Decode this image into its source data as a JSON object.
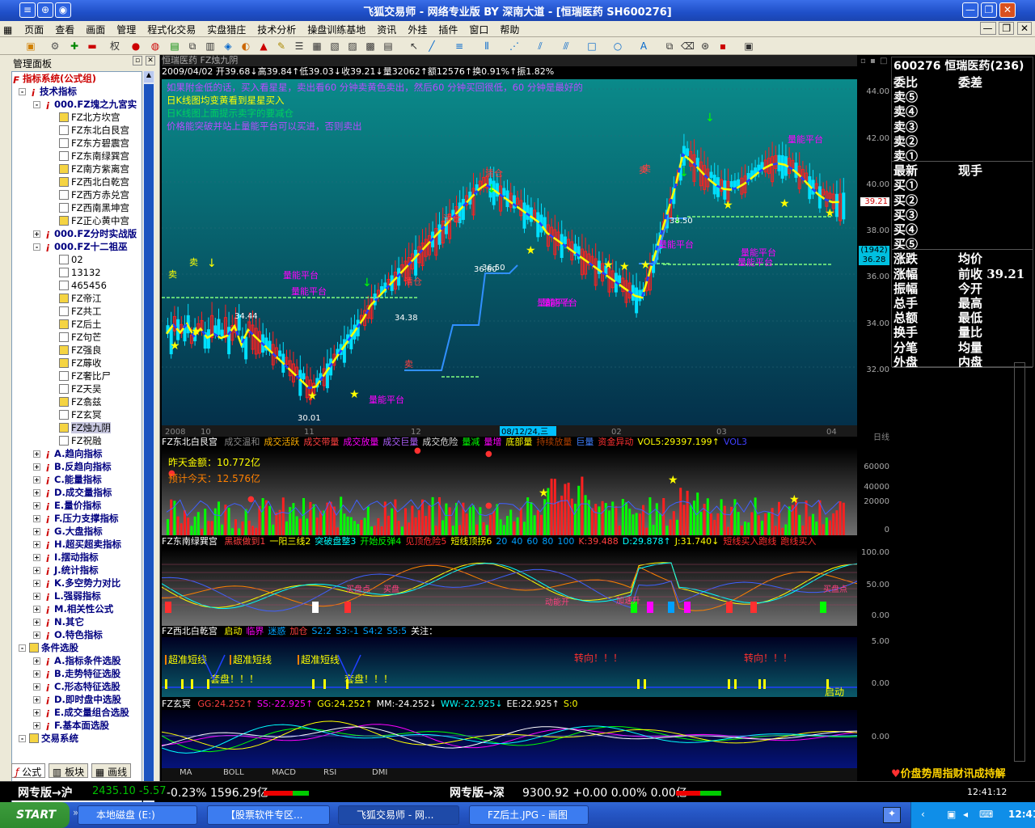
{
  "titlebar": {
    "title": "飞狐交易师 - 网络专业版 BY 深南大道 - [恒瑞医药 SH600276]"
  },
  "menu": [
    "页面",
    "查看",
    "画面",
    "管理",
    "程式化交易",
    "实盘猎庄",
    "技术分析",
    "操盘训练基地",
    "资讯",
    "外挂",
    "插件",
    "窗口",
    "帮助"
  ],
  "toolbar": {
    "period_label": "权"
  },
  "left_panel": {
    "title": "管理面板",
    "tree": [
      {
        "label": "指标系统(公式组)",
        "level": 0,
        "style": "red",
        "icon": "F"
      },
      {
        "label": "技术指标",
        "level": 1,
        "style": "bold",
        "icon": "i",
        "toggle": "-"
      },
      {
        "label": "000.FZ塊之九宮实",
        "level": 2,
        "style": "bold",
        "icon": "i",
        "toggle": "-"
      },
      {
        "label": "FZ北方坎宫",
        "level": 3,
        "icon": "yel"
      },
      {
        "label": "FZ东北白艮宫",
        "level": 3,
        "icon": "box"
      },
      {
        "label": "FZ东方碧震宫",
        "level": 3,
        "icon": "box"
      },
      {
        "label": "FZ东南绿巽宫",
        "level": 3,
        "icon": "box"
      },
      {
        "label": "FZ南方紫离宫",
        "level": 3,
        "icon": "yel"
      },
      {
        "label": "FZ西北白乾宫",
        "level": 3,
        "icon": "yel"
      },
      {
        "label": "FZ西方赤兑宫",
        "level": 3,
        "icon": "box"
      },
      {
        "label": "FZ西南黑坤宫",
        "level": 3,
        "icon": "box"
      },
      {
        "label": "FZ正心黄中宫",
        "level": 3,
        "icon": "yel"
      },
      {
        "label": "000.FZ分时实战版",
        "level": 2,
        "style": "bold",
        "icon": "i",
        "toggle": "+"
      },
      {
        "label": "000.FZ十二祖巫",
        "level": 2,
        "style": "bold",
        "icon": "i",
        "toggle": "-"
      },
      {
        "label": "02",
        "level": 3,
        "icon": "box"
      },
      {
        "label": "13132",
        "level": 3,
        "icon": "box"
      },
      {
        "label": "465456",
        "level": 3,
        "icon": "box"
      },
      {
        "label": "FZ帝江",
        "level": 3,
        "icon": "yel"
      },
      {
        "label": "FZ共工",
        "level": 3,
        "icon": "box"
      },
      {
        "label": "FZ后土",
        "level": 3,
        "icon": "yel"
      },
      {
        "label": "FZ句芒",
        "level": 3,
        "icon": "box"
      },
      {
        "label": "FZ强良",
        "level": 3,
        "icon": "yel"
      },
      {
        "label": "FZ蓐收",
        "level": 3,
        "icon": "yel"
      },
      {
        "label": "FZ奢比尸",
        "level": 3,
        "icon": "box"
      },
      {
        "label": "FZ天吴",
        "level": 3,
        "icon": "box"
      },
      {
        "label": "FZ翕兹",
        "level": 3,
        "icon": "yel"
      },
      {
        "label": "FZ玄冥",
        "level": 3,
        "icon": "box"
      },
      {
        "label": "FZ烛九阴",
        "level": 3,
        "icon": "yel",
        "selected": true
      },
      {
        "label": "FZ祝融",
        "level": 3,
        "icon": "box"
      },
      {
        "label": "A.趋向指标",
        "level": 2,
        "style": "bold",
        "icon": "i",
        "toggle": "+"
      },
      {
        "label": "B.反趋向指标",
        "level": 2,
        "style": "bold",
        "icon": "i",
        "toggle": "+"
      },
      {
        "label": "C.能量指标",
        "level": 2,
        "style": "bold",
        "icon": "i",
        "toggle": "+"
      },
      {
        "label": "D.成交量指标",
        "level": 2,
        "style": "bold",
        "icon": "i",
        "toggle": "+"
      },
      {
        "label": "E.量价指标",
        "level": 2,
        "style": "bold",
        "icon": "i",
        "toggle": "+"
      },
      {
        "label": "F.压力支撑指标",
        "level": 2,
        "style": "bold",
        "icon": "i",
        "toggle": "+"
      },
      {
        "label": "G.大盘指标",
        "level": 2,
        "style": "bold",
        "icon": "i",
        "toggle": "+"
      },
      {
        "label": "H.超买超卖指标",
        "level": 2,
        "style": "bold",
        "icon": "i",
        "toggle": "+"
      },
      {
        "label": "I.摆动指标",
        "level": 2,
        "style": "bold",
        "icon": "i",
        "toggle": "+"
      },
      {
        "label": "J.统计指标",
        "level": 2,
        "style": "bold",
        "icon": "i",
        "toggle": "+"
      },
      {
        "label": "K.多空势力对比",
        "level": 2,
        "style": "bold",
        "icon": "i",
        "toggle": "+"
      },
      {
        "label": "L.强弱指标",
        "level": 2,
        "style": "bold",
        "icon": "i",
        "toggle": "+"
      },
      {
        "label": "M.相关性公式",
        "level": 2,
        "style": "bold",
        "icon": "i",
        "toggle": "+"
      },
      {
        "label": "N.其它",
        "level": 2,
        "style": "bold",
        "icon": "i",
        "toggle": "+"
      },
      {
        "label": "O.特色指标",
        "level": 2,
        "style": "bold",
        "icon": "i",
        "toggle": "+"
      },
      {
        "label": "条件选股",
        "level": 1,
        "style": "bold",
        "icon": "yel",
        "toggle": "-"
      },
      {
        "label": "A.指标条件选股",
        "level": 2,
        "style": "bold",
        "icon": "i",
        "toggle": "+"
      },
      {
        "label": "B.走势特征选股",
        "level": 2,
        "style": "bold",
        "icon": "i",
        "toggle": "+"
      },
      {
        "label": "C.形态特征选股",
        "level": 2,
        "style": "bold",
        "icon": "i",
        "toggle": "+"
      },
      {
        "label": "D.即时盘中选股",
        "level": 2,
        "style": "bold",
        "icon": "i",
        "toggle": "+"
      },
      {
        "label": "E.成交量组合选股",
        "level": 2,
        "style": "bold",
        "icon": "i",
        "toggle": "+"
      },
      {
        "label": "F.基本面选股",
        "level": 2,
        "style": "bold",
        "icon": "i",
        "toggle": "+"
      },
      {
        "label": "交易系统",
        "level": 1,
        "style": "bold",
        "icon": "yel",
        "toggle": "-"
      }
    ],
    "tabs": [
      "公式",
      "板块",
      "画线"
    ]
  },
  "chart": {
    "stock_name": "恒瑞医药",
    "indicator_name": "FZ烛九阴",
    "info_line": "2009/04/02 开39.68↓高39.84↑低39.03↓收39.21↓量32062↑额12576↑换0.91%↑振1.82%",
    "tips": [
      "如果附金低的话，买入看星星，卖出看60 分钟卖黄色卖出，然后60 分钟买回很低，60 分钟是最好的",
      "日K线图均变黄看到星星买入",
      "日K线图上面提示卖字的要减仓",
      "价格能突破并站上量能平台可以买进，否则卖出"
    ],
    "tips_colors": [
      "#b94cff",
      "#ffff00",
      "#00a0ff",
      "#00d060",
      "#b94cff"
    ],
    "price_axis": [
      "44.00",
      "42.00",
      "40.00",
      "38.00",
      "36.00",
      "34.00",
      "32.00"
    ],
    "price_tag": "39.21",
    "price_tag2_top": "(1942)",
    "price_tag2": "36.28",
    "time_axis": [
      "2008",
      "10",
      "11",
      "12",
      "02",
      "03",
      "04"
    ],
    "time_cursor": "08/12/24,三",
    "date_label": "日线",
    "low_label": "30.01",
    "annotations": [
      "卖",
      "卖",
      "清仓",
      "卖",
      "量能平台",
      "量能平台",
      "量能平台",
      "量能平台",
      "量能平台",
      "量能平台",
      "量能平台",
      "量能平台",
      "量能平台",
      "卖",
      "清仓",
      "清仓",
      "卖"
    ],
    "platform_values": [
      "34.44",
      "34.38",
      "36.50",
      "36.60",
      "38.50"
    ]
  },
  "panel2": {
    "title": "FZ东北白艮宫",
    "legend": [
      "成交温和",
      "成交活跃",
      "成交带量",
      "成交放量",
      "成交巨量",
      "成交危险",
      "量减",
      "量增",
      "底部量",
      "持续放量",
      "巨量",
      "资金异动",
      "VOL5:29397.199↑",
      "VOL3"
    ],
    "legend_colors": [
      "#888",
      "#ffb000",
      "#ff4040",
      "#ff00ff",
      "#b060ff",
      "#ddd",
      "#00ff00",
      "#ff00ff",
      "#ffff00",
      "#b04000",
      "#4080ff",
      "#ff3030",
      "#ffff00",
      "#4040ff"
    ],
    "amount_yesterday": "昨天金额：10.772亿",
    "amount_today": "预计今天：12.576亿",
    "axis": [
      "60000",
      "40000",
      "20000",
      "0"
    ]
  },
  "panel3": {
    "title": "FZ东南绿巽宫",
    "legend": [
      "黑碳做到1",
      "一阳三线2",
      "突破盘整3",
      "开始反弹4",
      "见顶危险5",
      "短线顶拐6",
      "20",
      "40",
      "60",
      "80",
      "100",
      "K:39.488",
      "D:29.878↑",
      "J:31.740↓",
      "短线买入跑线",
      "跑线买入"
    ],
    "axis": [
      "100.00",
      "50.00",
      "0.00"
    ],
    "labels": [
      "买盘点",
      "买盘",
      "动能开",
      "加速升",
      "买盘点"
    ]
  },
  "panel4": {
    "title": "FZ西北白乾宫",
    "legend": [
      "启动",
      "临界",
      "迷惑",
      "加仓",
      "S2:2",
      "S3:-1",
      "S4:2",
      "S5:5",
      "关注："
    ],
    "axis": [
      "5.00",
      "0.00"
    ],
    "labels": [
      "超准短线",
      "超准短线",
      "超准短线",
      "转向！！！",
      "转向！！！",
      "套盘！！！",
      "套盘！！！",
      "启动"
    ]
  },
  "panel5": {
    "title": "FZ玄冥",
    "legend": [
      "GG:24.252↑",
      "SS:-22.925↑",
      "GG:24.252↑",
      "MM:-24.252↓",
      "WW:-22.925↓",
      "EE:22.925↑",
      "S:0"
    ],
    "axis": [
      "0.00"
    ]
  },
  "bottom_tabs": [
    "MA",
    "BOLL",
    "MACD",
    "RSI",
    "DMI"
  ],
  "quote": {
    "header": "600276 恒瑞医药(236)",
    "rows": [
      [
        "委比",
        "委差"
      ],
      [
        "卖⑤",
        ""
      ],
      [
        "卖④",
        ""
      ],
      [
        "卖③",
        ""
      ],
      [
        "卖②",
        ""
      ],
      [
        "卖①",
        ""
      ],
      [
        "最新",
        "现手"
      ],
      [
        "买①",
        ""
      ],
      [
        "买②",
        ""
      ],
      [
        "买③",
        ""
      ],
      [
        "买④",
        ""
      ],
      [
        "买⑤",
        ""
      ],
      [
        "涨跌",
        "均价"
      ],
      [
        "涨幅",
        "前收 39.21"
      ],
      [
        "振幅",
        "今开"
      ],
      [
        "总手",
        "最高"
      ],
      [
        "总额",
        "最低"
      ],
      [
        "换手",
        "量比"
      ],
      [
        "分笔",
        "均量"
      ],
      [
        "外盘",
        "内盘"
      ]
    ],
    "banner": "价盘势周指财讯成持解",
    "time": "12:41:12"
  },
  "status": {
    "sh_label": "网专版→沪",
    "sh_value": "2435.10 -5.57",
    "sh_pct": "-0.23% 1596.29亿",
    "sz_label": "网专版→深",
    "sz_value": "9300.92 +0.00 0.00% 0.00亿"
  },
  "taskbar": {
    "start": "START",
    "tasks": [
      "本地磁盘 (E:)",
      "【股票软件专区...",
      "飞狐交易师 - 网...",
      "FZ后土.JPG - 画图"
    ],
    "clock": "12:41"
  }
}
